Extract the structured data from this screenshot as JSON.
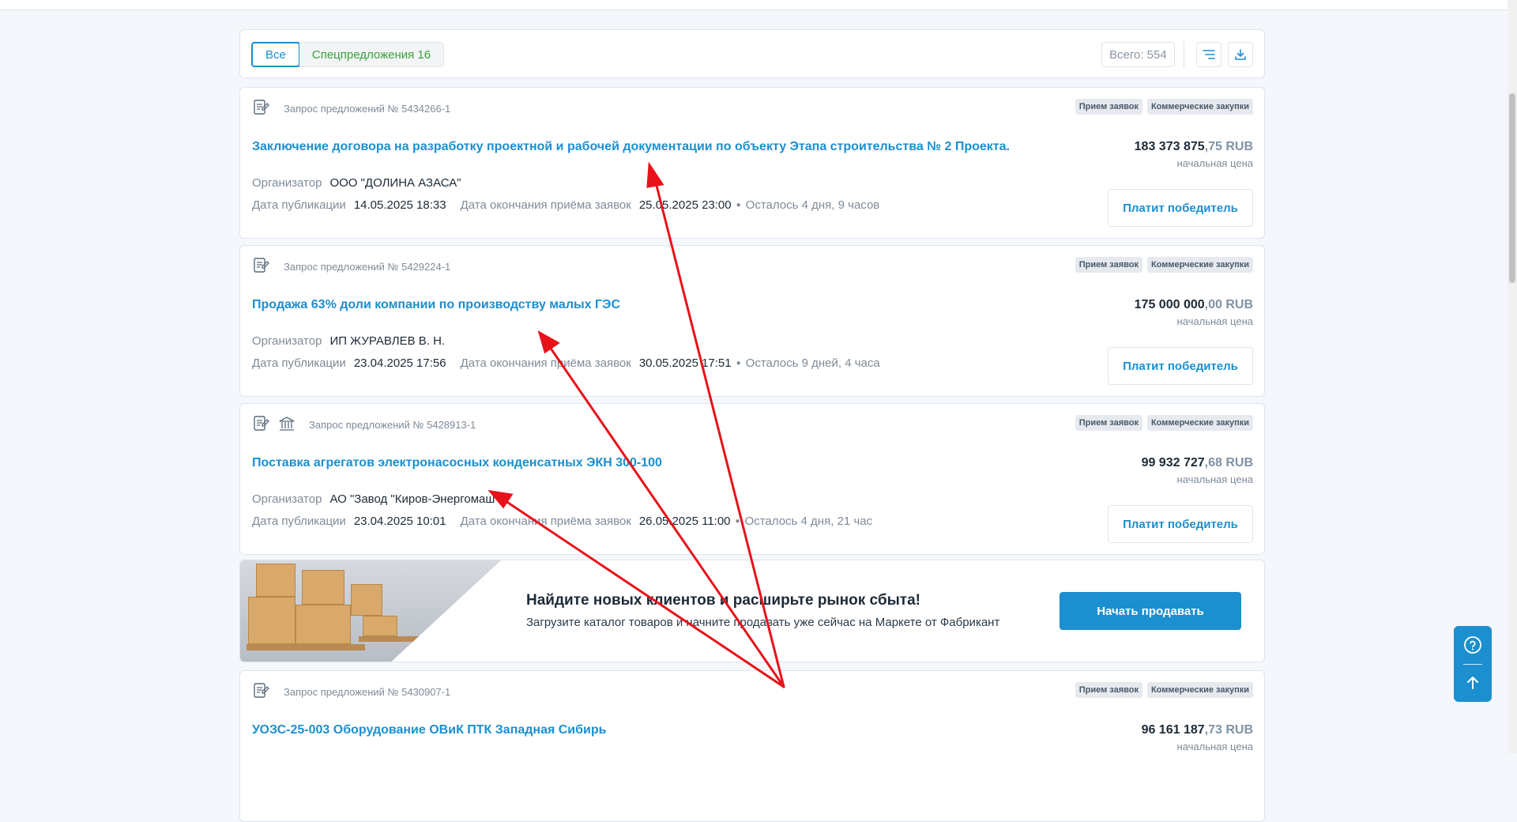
{
  "filter": {
    "tab_all": "Все",
    "tab_special": "Спецпредложения 16",
    "total": "Всего: 554"
  },
  "icons": {
    "filter": "filter-lines-icon",
    "download": "download-icon",
    "document": "document-pen-icon",
    "bank": "bank-building-icon",
    "help": "question-circle-icon",
    "up": "arrow-up-icon"
  },
  "labels": {
    "organizer": "Организатор",
    "published": "Дата публикации",
    "deadline": "Дата окончания приёма заявок",
    "price_note": "начальная цена",
    "pay": "Платит победитель",
    "tag_status": "Прием заявок",
    "tag_type": "Коммерческие закупки"
  },
  "cards": [
    {
      "request": "Запрос предложений № 5434266-1",
      "title": "Заключение договора на разработку проектной и рабочей документации по объекту Этапа строительства № 2 Проекта.",
      "price_main": "183 373 875",
      "price_cents": ",75 RUB",
      "organizer": "ООО \"ДОЛИНА АЗАСА\"",
      "published": "14.05.2025 18:33",
      "deadline": "25.05.2025 23:00",
      "remaining": "Осталось 4 дня, 9 часов"
    },
    {
      "request": "Запрос предложений № 5429224-1",
      "title": "Продажа 63% доли компании по производству малых ГЭС",
      "price_main": "175 000 000",
      "price_cents": ",00 RUB",
      "organizer": "ИП ЖУРАВЛЕВ В. Н.",
      "published": "23.04.2025 17:56",
      "deadline": "30.05.2025 17:51",
      "remaining": "Осталось 9 дней, 4 часа"
    },
    {
      "request": "Запрос предложений № 5428913-1",
      "title": "Поставка агрегатов электронасосных конденсатных ЭКН 300-100",
      "price_main": "99 932 727",
      "price_cents": ",68 RUB",
      "organizer": "АО \"Завод \"Киров-Энергомаш\"",
      "published": "23.04.2025 10:01",
      "deadline": "26.05.2025 11:00",
      "remaining": "Осталось 4 дня, 21 час"
    },
    {
      "request": "Запрос предложений № 5430907-1",
      "title": "УОЗС-25-003 Оборудование ОВиК ПТК Западная Сибирь",
      "price_main": "96 161 187",
      "price_cents": ",73 RUB",
      "organizer": "",
      "published": "",
      "deadline": "",
      "remaining": ""
    }
  ],
  "promo": {
    "title": "Найдите новых клиентов и расширьте рынок сбыта!",
    "subtitle": "Загрузите каталог товаров и начните продавать уже сейчас на Маркете от Фабрикант",
    "button": "Начать продавать"
  },
  "colors": {
    "accent": "#1b8fd0",
    "special_tab": "#3aa23a",
    "annotation_arrow": "#e8121a"
  }
}
